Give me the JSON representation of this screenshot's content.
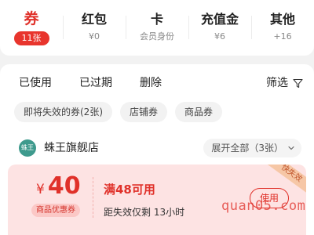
{
  "categories": [
    {
      "title": "券",
      "sub": "11张"
    },
    {
      "title": "红包",
      "sub": "¥0"
    },
    {
      "title": "卡",
      "sub": "会员身份"
    },
    {
      "title": "充值金",
      "sub": "¥6"
    },
    {
      "title": "其他",
      "sub": "+16"
    }
  ],
  "status_tabs": {
    "used": "已使用",
    "expired": "已过期",
    "delete": "删除"
  },
  "filter": {
    "label": "筛选",
    "icon": "funnel-icon"
  },
  "chips": [
    "即将失效的券(2张)",
    "店铺券",
    "商品券"
  ],
  "store": {
    "logo_text": "蛛王",
    "name": "蛛王旗舰店",
    "expand_label": "展开全部（3张）",
    "expand_icon": "chevron-down-icon"
  },
  "coupon": {
    "symbol": "¥",
    "amount": "40",
    "type": "商品优惠券",
    "condition": "满48可用",
    "countdown": "距失效仅剩 13小时",
    "ribbon": "快失效",
    "button": "使用"
  },
  "watermark": "quan05.com",
  "colors": {
    "accent": "#e0312a",
    "coupon_bg": "#fde3e3",
    "logo": "#3e9a8d"
  }
}
